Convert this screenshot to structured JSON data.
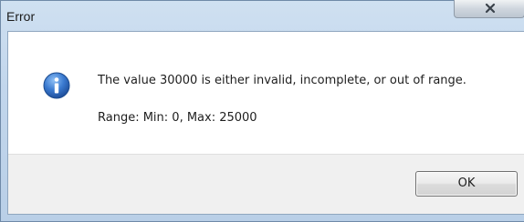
{
  "window": {
    "title": "Error"
  },
  "titlebar": {
    "close_icon": "close-icon"
  },
  "dialog": {
    "icon": "info-icon",
    "message": "The value 30000 is either invalid, incomplete, or out of range.",
    "range": "Range: Min: 0, Max: 25000"
  },
  "buttons": {
    "ok_label": "OK"
  },
  "colors": {
    "titlebar": "#c2d6ec",
    "close_button": "#cfd6de",
    "info_icon": "#2b64b8",
    "footer": "#f0f0f0"
  }
}
